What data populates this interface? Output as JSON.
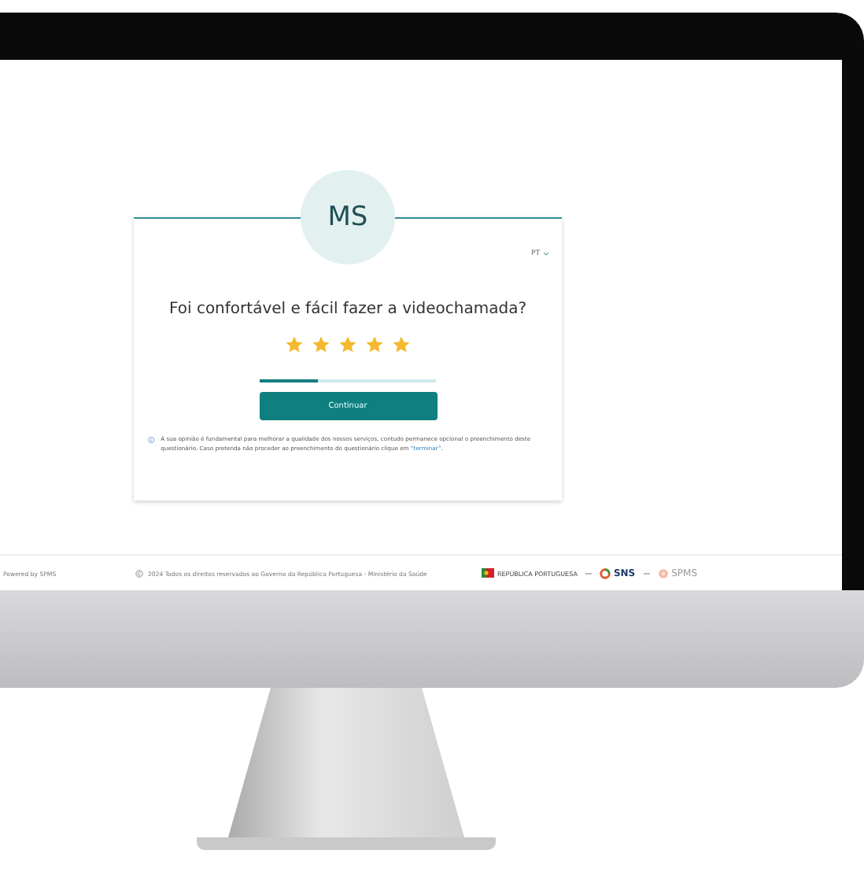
{
  "card": {
    "avatar": "MS",
    "language": "PT",
    "question": "Foi confortável e fácil fazer a videochamada?",
    "stars": 5,
    "progress": {
      "level": 0.33
    },
    "button": "Continuar",
    "info": {
      "text": "A sua opinião é fundamental para melhorar a qualidade dos nossos serviços, contudo permanece opcional o preenchimento deste questionário. Caso pretenda não proceder ao preenchimento do questionário clique em “",
      "link": "terminar",
      "after": "”."
    }
  },
  "footer": {
    "powered": "Powered by SPMS",
    "copyright": "2024 Todos os direitos reservados ao Governo da República Portuguesa - Ministério da Saúde",
    "logos": [
      {
        "kind": "gov",
        "text": "REPÚBLICA PORTUGUESA"
      },
      {
        "kind": "sns",
        "text": "SNS"
      },
      {
        "kind": "spms",
        "text": "SPMS"
      }
    ]
  }
}
